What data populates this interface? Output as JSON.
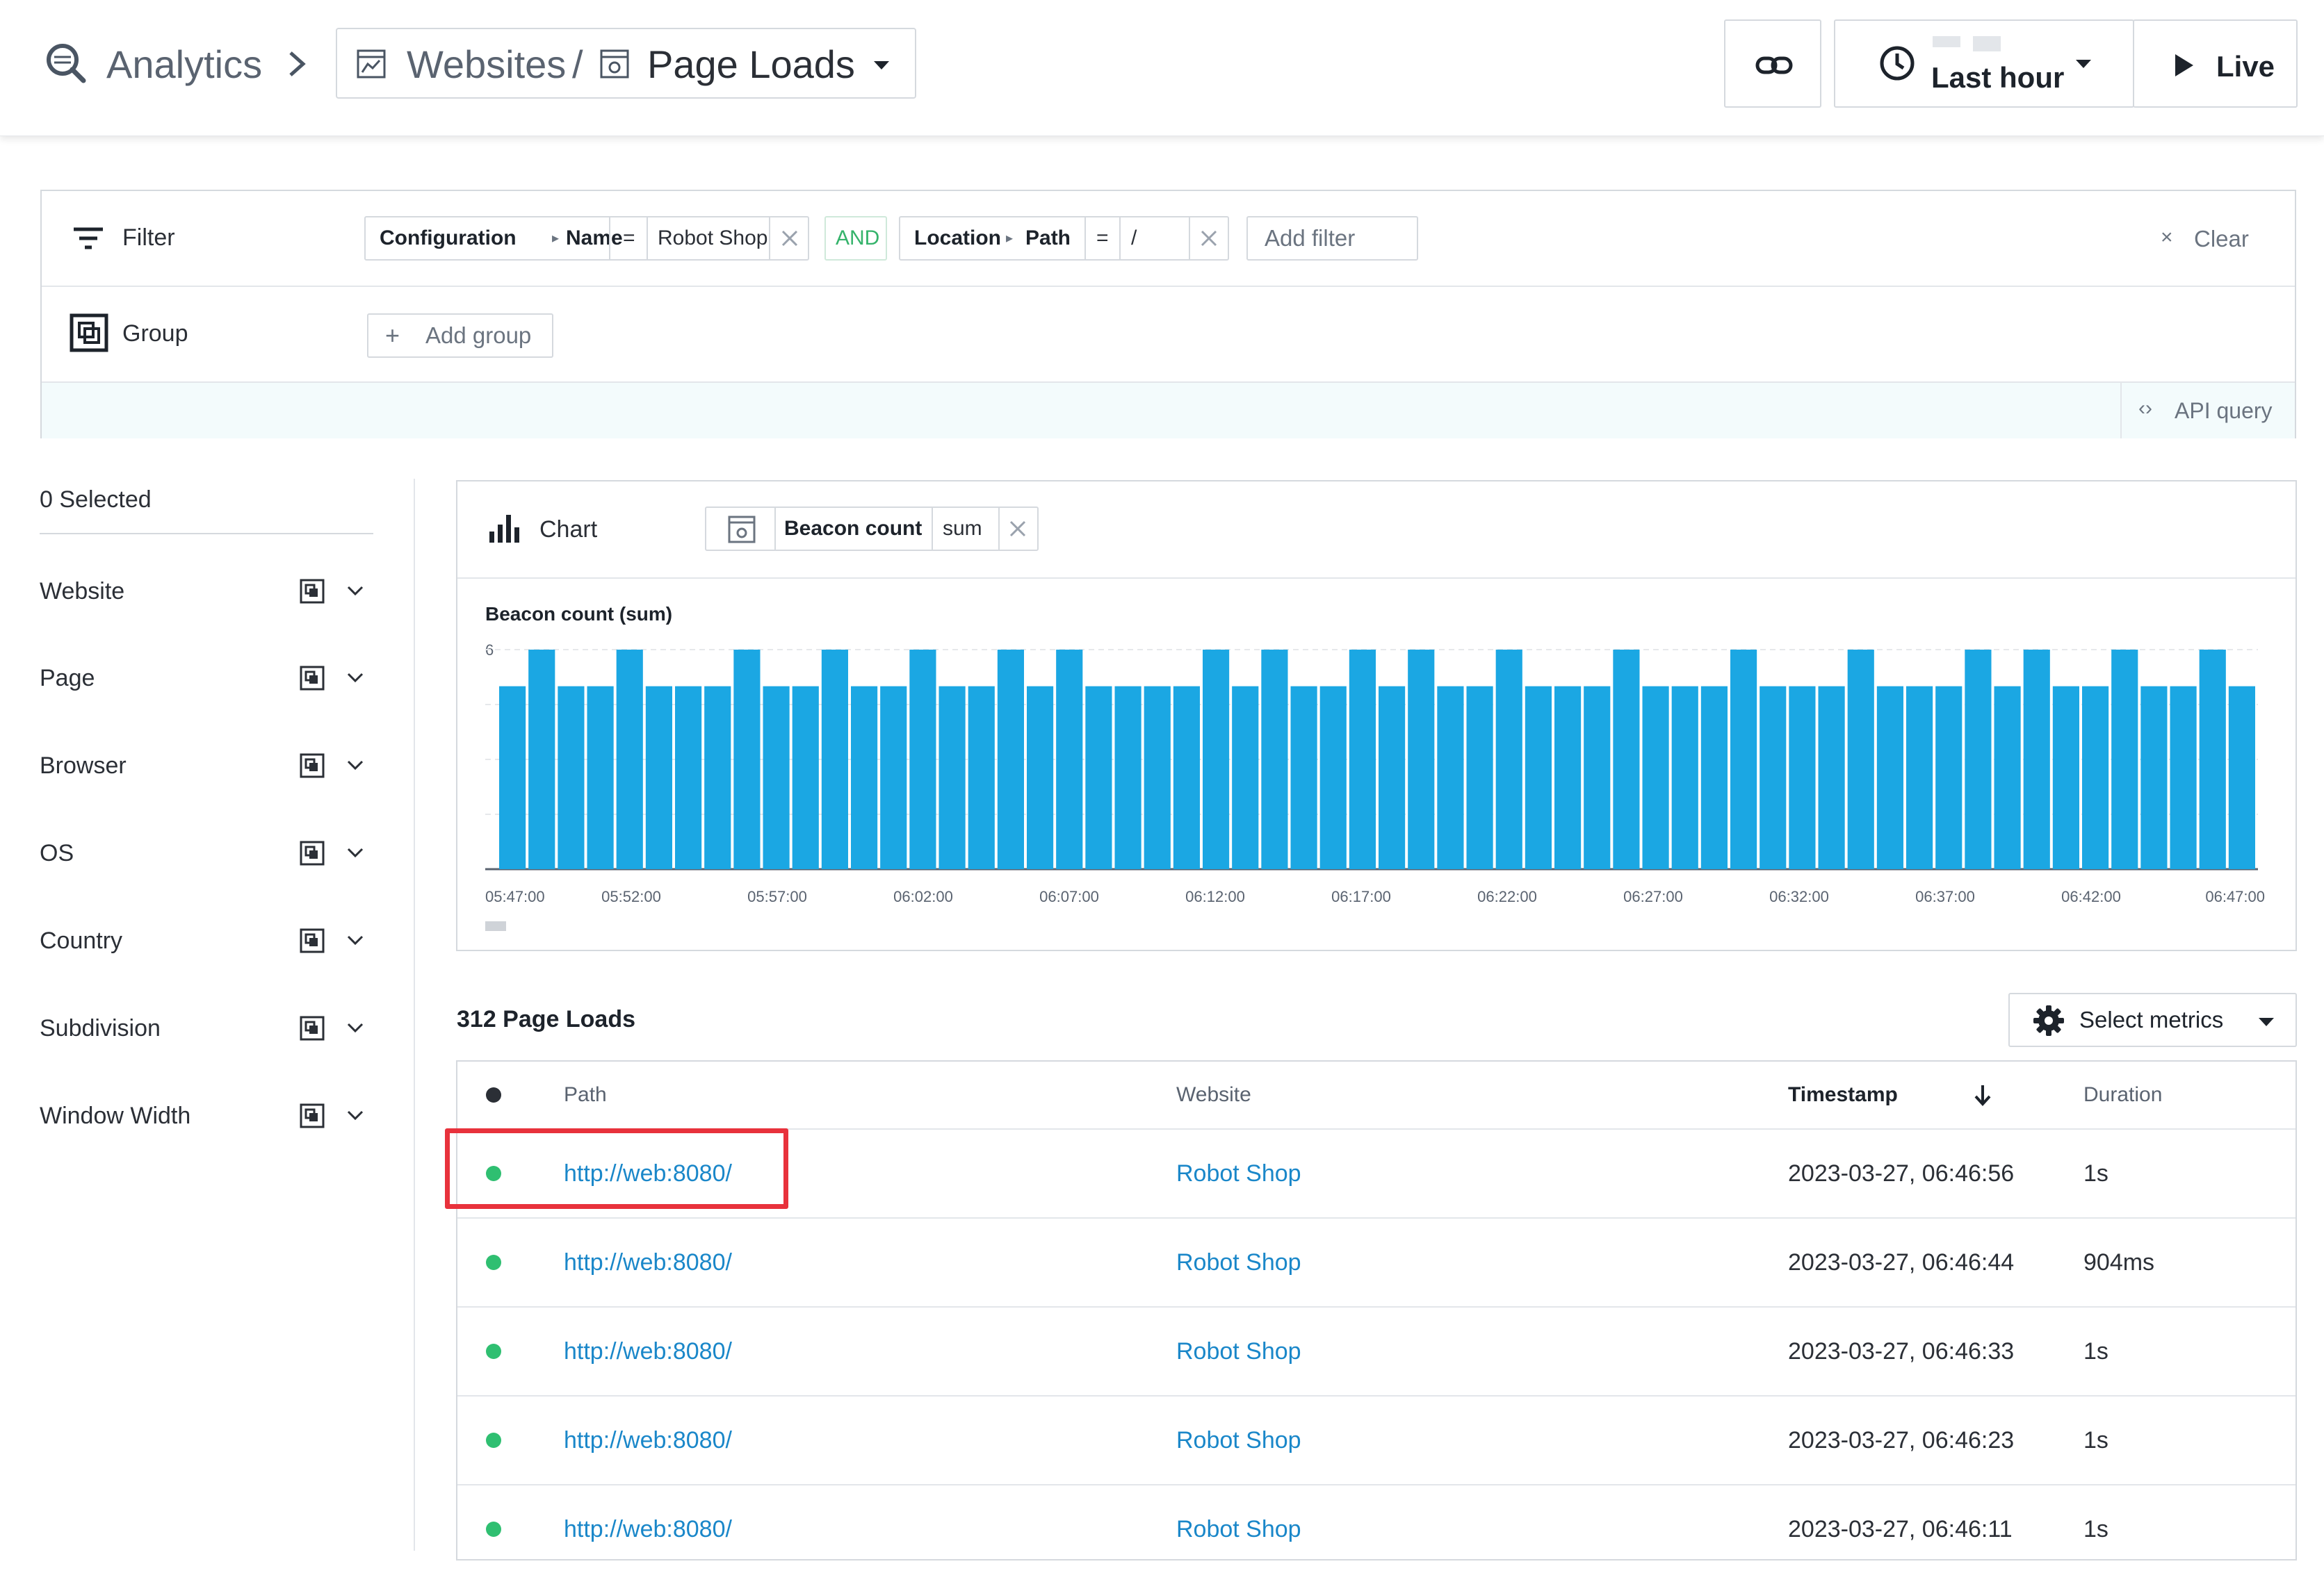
{
  "header": {
    "app_label": "Analytics",
    "crumb_websites": "Websites",
    "crumb_slash": "/",
    "crumb_page": "Page Loads",
    "time_range": "Last hour",
    "live_label": "Live"
  },
  "filter": {
    "label": "Filter",
    "chip1": {
      "category": "Configuration",
      "field": "Name",
      "op": "=",
      "value": "Robot Shop"
    },
    "and_label": "AND",
    "chip2": {
      "category": "Location",
      "field": "Path",
      "op": "=",
      "value": "/"
    },
    "add_filter": "Add filter",
    "clear": "Clear",
    "group_label": "Group",
    "add_group": "Add group",
    "api_query": "API query"
  },
  "sidebar": {
    "selected": "0 Selected",
    "items": [
      {
        "label": "Website"
      },
      {
        "label": "Page"
      },
      {
        "label": "Browser"
      },
      {
        "label": "OS"
      },
      {
        "label": "Country"
      },
      {
        "label": "Subdivision"
      },
      {
        "label": "Window Width"
      }
    ]
  },
  "chart_panel": {
    "label": "Chart",
    "metric": "Beacon count",
    "aggregation": "sum",
    "accent": "#1ba7e3"
  },
  "chart_data": {
    "type": "bar",
    "title": "Beacon count (sum)",
    "xlabel": "",
    "ylabel": "",
    "ylim": [
      0,
      6
    ],
    "y_ticks": [
      "6"
    ],
    "x_tick_labels": [
      "05:47:00",
      "05:52:00",
      "05:57:00",
      "06:02:00",
      "06:07:00",
      "06:12:00",
      "06:17:00",
      "06:22:00",
      "06:27:00",
      "06:32:00",
      "06:37:00",
      "06:42:00",
      "06:47:00"
    ],
    "series": [
      {
        "values": [
          5,
          6,
          5,
          5,
          6,
          5,
          5,
          5,
          6,
          5,
          5,
          6,
          5,
          5,
          6,
          5,
          5,
          6,
          5,
          6,
          5,
          5,
          5,
          5,
          6,
          5,
          6,
          5,
          5,
          6,
          5,
          6,
          5,
          5,
          6,
          5,
          5,
          5,
          6,
          5,
          5,
          5,
          6,
          5,
          5,
          5,
          6,
          5,
          5,
          5,
          6,
          5,
          6,
          5,
          5,
          6,
          5,
          5,
          6,
          5
        ]
      }
    ]
  },
  "table": {
    "count_title": "312 Page Loads",
    "select_metrics": "Select metrics",
    "columns": {
      "path": "Path",
      "website": "Website",
      "timestamp": "Timestamp",
      "duration": "Duration"
    },
    "rows": [
      {
        "path": "http://web:8080/",
        "website": "Robot Shop",
        "timestamp": "2023-03-27, 06:46:56",
        "duration": "1s"
      },
      {
        "path": "http://web:8080/",
        "website": "Robot Shop",
        "timestamp": "2023-03-27, 06:46:44",
        "duration": "904ms"
      },
      {
        "path": "http://web:8080/",
        "website": "Robot Shop",
        "timestamp": "2023-03-27, 06:46:33",
        "duration": "1s"
      },
      {
        "path": "http://web:8080/",
        "website": "Robot Shop",
        "timestamp": "2023-03-27, 06:46:23",
        "duration": "1s"
      },
      {
        "path": "http://web:8080/",
        "website": "Robot Shop",
        "timestamp": "2023-03-27, 06:46:11",
        "duration": "1s"
      }
    ],
    "status_color": "#2fbf71",
    "highlight_color": "#e8323c"
  }
}
